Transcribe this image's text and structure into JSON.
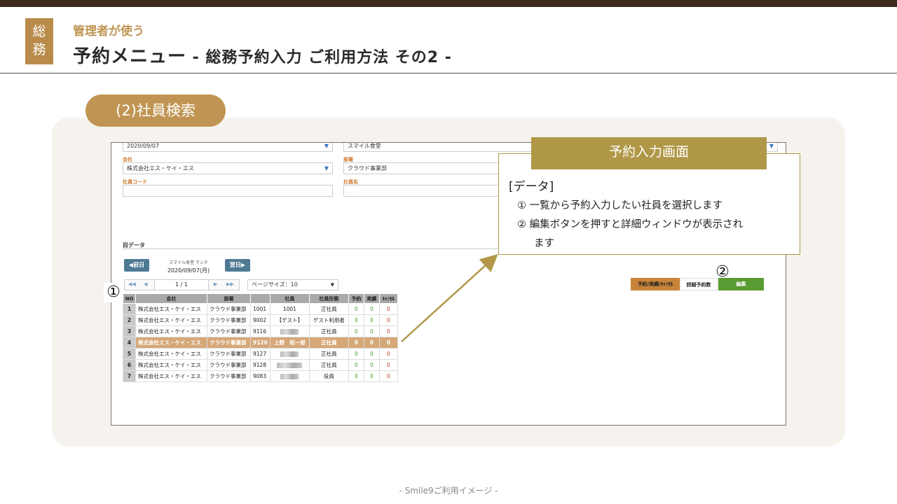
{
  "header": {
    "badge": [
      "総",
      "務"
    ],
    "subtitle": "管理者が使う",
    "title_main": "予約メニュー",
    "title_rest": " - 総務予約入力 ご利用方法 その2 -"
  },
  "section_label": "(2)社員検索",
  "screen": {
    "date_field": "2020/09/07",
    "cafeteria_field": "スマイル食堂",
    "company_label": "会社",
    "company_value": "株式会社エス・ケイ・エス",
    "dept_label": "部署",
    "dept_value": "クラウド事業部",
    "empcode_label": "社員コード",
    "empname_label": "社員名",
    "data_section": "目データ",
    "prev_label": "◀前日",
    "next_label": "翌日▶",
    "meal_label": "スマイル食堂 ランチ",
    "current_date": "2020/09/07(月)",
    "pager_first": "◀◀",
    "pager_prev": "◀",
    "pager_next": "▶",
    "pager_last": "▶▶",
    "page": "1 / 1",
    "page_size": "ページサイズ：10",
    "columns": [
      "NO",
      "会社",
      "部署",
      "",
      "社員",
      "社員形態",
      "予約",
      "実績",
      "ｷｬﾝｾﾙ"
    ],
    "rows": [
      {
        "no": "1",
        "company": "株式会社エス・ケイ・エス",
        "dept": "クラウド事業部",
        "code": "1001",
        "name": "1001",
        "type": "正社員",
        "res": "0",
        "act": "0",
        "cancel": "0"
      },
      {
        "no": "2",
        "company": "株式会社エス・ケイ・エス",
        "dept": "クラウド事業部",
        "code": "9002",
        "name": "【ゲスト】",
        "type": "ゲスト利用者",
        "res": "0",
        "act": "0",
        "cancel": "0"
      },
      {
        "no": "3",
        "company": "株式会社エス・ケイ・エス",
        "dept": "クラウド事業部",
        "code": "9116",
        "name": "",
        "type": "正社員",
        "res": "0",
        "act": "0",
        "cancel": "0"
      },
      {
        "no": "4",
        "company": "株式会社エス・ケイ・エス",
        "dept": "クラウド事業部",
        "code": "9120",
        "name": "上野　昭一郎",
        "type": "正社員",
        "res": "0",
        "act": "0",
        "cancel": "0"
      },
      {
        "no": "5",
        "company": "株式会社エス・ケイ・エス",
        "dept": "クラウド事業部",
        "code": "9127",
        "name": "",
        "type": "正社員",
        "res": "0",
        "act": "0",
        "cancel": "0"
      },
      {
        "no": "6",
        "company": "株式会社エス・ケイ・エス",
        "dept": "クラウド事業部",
        "code": "9128",
        "name": "",
        "type": "正社員",
        "res": "0",
        "act": "0",
        "cancel": "0"
      },
      {
        "no": "7",
        "company": "株式会社エス・ケイ・エス",
        "dept": "クラウド事業部",
        "code": "9083",
        "name": "",
        "type": "役員",
        "res": "0",
        "act": "0",
        "cancel": "0"
      }
    ],
    "btn_reservation": "予約/実績/ｷｬﾝｾﾙ",
    "btn_detail_count": "詳細予約数",
    "btn_edit": "編集"
  },
  "callout": {
    "title": "予約入力画面",
    "head": "[データ]",
    "line1": "① 一覧から予約入力したい社員を選択します",
    "line2": "② 編集ボタンを押すと詳細ウィンドウが表示され",
    "line3": "ます"
  },
  "markers": {
    "one": "①",
    "two": "②"
  },
  "footer": "- Smile9ご利用イメージ -",
  "colors": {
    "accent": "#c09553",
    "dark": "#3e2a1f",
    "callout": "#b09848",
    "edit_green": "#5a9a32",
    "highlight_row": "#d6a878"
  }
}
